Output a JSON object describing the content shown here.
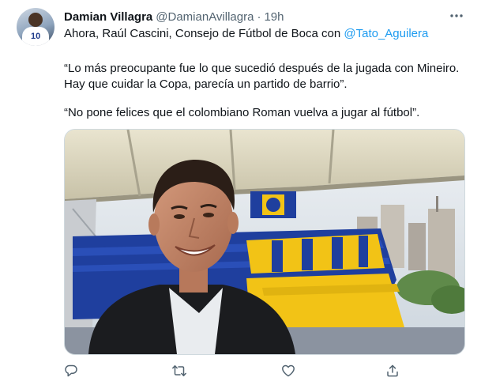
{
  "tweet": {
    "author_name": "Damian Villagra",
    "author_handle": "@DamianAvillagra",
    "separator": "·",
    "time": "19h",
    "text_line1_prefix": "Ahora, Raúl Cascini, Consejo de Fútbol de Boca con ",
    "mention": "@Tato_Aguilera",
    "quote1_line1": "“Lo más preocupante fue lo que sucedió después de la jugada con Mineiro.",
    "quote1_line2": "Hay que cuidar la Copa, parecía un partido de barrio”.",
    "quote2": "“No pone felices que el colombiano Roman vuelva a jugar al fútbol”.",
    "avatar_number": "10"
  },
  "icons": {
    "more": "more-horizontal-icon",
    "reply": "reply-icon",
    "retweet": "retweet-icon",
    "like": "like-icon",
    "share": "share-icon"
  },
  "colors": {
    "text": "#0f1419",
    "secondary": "#536471",
    "accent": "#1d9bf0",
    "stadium_blue": "#1f3f9e",
    "stadium_yellow": "#f2c316"
  }
}
